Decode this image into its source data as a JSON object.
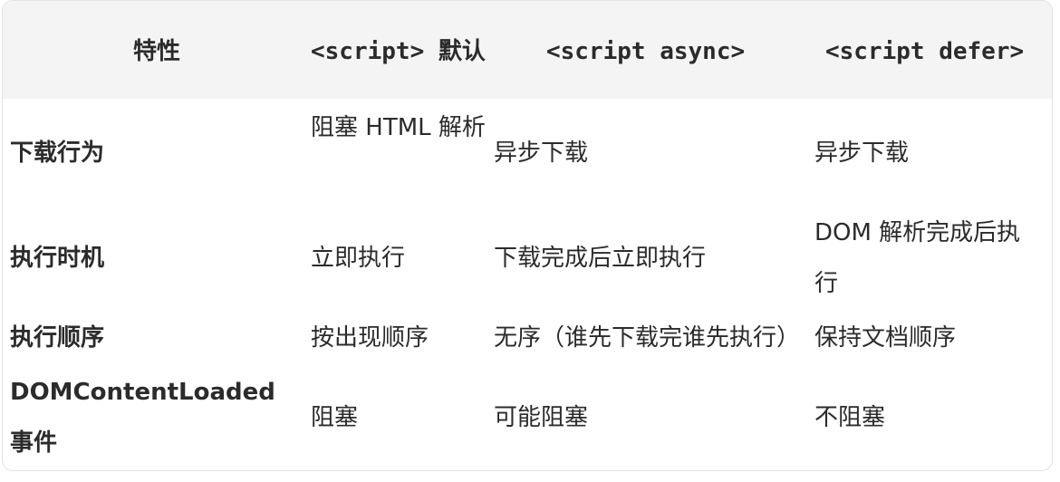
{
  "table": {
    "headers": [
      "特性",
      "<script> 默认",
      "<script async>",
      "<script defer>"
    ],
    "rows": [
      {
        "label": "下载行为",
        "default": "阻塞 HTML 解析",
        "async": "异步下载",
        "defer": "异步下载"
      },
      {
        "label": "执行时机",
        "default": "立即执行",
        "async": "下载完成后立即执行",
        "defer": "DOM 解析完成后执行"
      },
      {
        "label": "执行顺序",
        "default": "按出现顺序",
        "async": "无序（谁先下载完谁先执行）",
        "defer": "保持文档顺序"
      },
      {
        "label": "DOMContentLoaded 事件",
        "default": "阻塞",
        "async": "可能阻塞",
        "defer": "不阻塞"
      }
    ]
  }
}
